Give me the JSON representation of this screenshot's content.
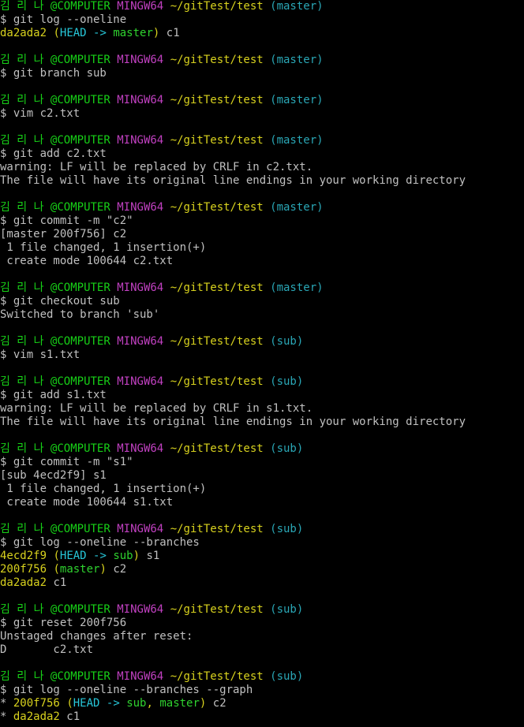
{
  "terminal": {
    "colors": {
      "background": "#000000",
      "default_text": "#c0c0c0",
      "user_host": "#17d017",
      "system": "#c040c0",
      "path": "#d8d21e",
      "branch": "#2aa7b6",
      "commit_hash": "#d8d21e",
      "head_ref": "#27c7d9",
      "branch_ref": "#2fd22f"
    },
    "lines": [
      [
        {
          "t": "김 리 나 @COMPUTER",
          "c": "green"
        },
        {
          "t": " ",
          "c": "white"
        },
        {
          "t": "MINGW64",
          "c": "magenta"
        },
        {
          "t": " ",
          "c": "white"
        },
        {
          "t": "~/gitTest/test",
          "c": "yellow"
        },
        {
          "t": " ",
          "c": "white"
        },
        {
          "t": "(master)",
          "c": "cyan"
        }
      ],
      [
        {
          "t": "$ git log --oneline",
          "c": "white"
        }
      ],
      [
        {
          "t": "da2ada2",
          "c": "yellow"
        },
        {
          "t": " ",
          "c": "white"
        },
        {
          "t": "(",
          "c": "yellow"
        },
        {
          "t": "HEAD -> ",
          "c": "cyanb"
        },
        {
          "t": "master",
          "c": "greenb"
        },
        {
          "t": ")",
          "c": "yellow"
        },
        {
          "t": " c1",
          "c": "white"
        }
      ],
      [],
      [
        {
          "t": "김 리 나 @COMPUTER",
          "c": "green"
        },
        {
          "t": " ",
          "c": "white"
        },
        {
          "t": "MINGW64",
          "c": "magenta"
        },
        {
          "t": " ",
          "c": "white"
        },
        {
          "t": "~/gitTest/test",
          "c": "yellow"
        },
        {
          "t": " ",
          "c": "white"
        },
        {
          "t": "(master)",
          "c": "cyan"
        }
      ],
      [
        {
          "t": "$ git branch sub",
          "c": "white"
        }
      ],
      [],
      [
        {
          "t": "김 리 나 @COMPUTER",
          "c": "green"
        },
        {
          "t": " ",
          "c": "white"
        },
        {
          "t": "MINGW64",
          "c": "magenta"
        },
        {
          "t": " ",
          "c": "white"
        },
        {
          "t": "~/gitTest/test",
          "c": "yellow"
        },
        {
          "t": " ",
          "c": "white"
        },
        {
          "t": "(master)",
          "c": "cyan"
        }
      ],
      [
        {
          "t": "$ vim c2.txt",
          "c": "white"
        }
      ],
      [],
      [
        {
          "t": "김 리 나 @COMPUTER",
          "c": "green"
        },
        {
          "t": " ",
          "c": "white"
        },
        {
          "t": "MINGW64",
          "c": "magenta"
        },
        {
          "t": " ",
          "c": "white"
        },
        {
          "t": "~/gitTest/test",
          "c": "yellow"
        },
        {
          "t": " ",
          "c": "white"
        },
        {
          "t": "(master)",
          "c": "cyan"
        }
      ],
      [
        {
          "t": "$ git add c2.txt",
          "c": "white"
        }
      ],
      [
        {
          "t": "warning: LF will be replaced by CRLF in c2.txt.",
          "c": "white"
        }
      ],
      [
        {
          "t": "The file will have its original line endings in your working directory",
          "c": "white"
        }
      ],
      [],
      [
        {
          "t": "김 리 나 @COMPUTER",
          "c": "green"
        },
        {
          "t": " ",
          "c": "white"
        },
        {
          "t": "MINGW64",
          "c": "magenta"
        },
        {
          "t": " ",
          "c": "white"
        },
        {
          "t": "~/gitTest/test",
          "c": "yellow"
        },
        {
          "t": " ",
          "c": "white"
        },
        {
          "t": "(master)",
          "c": "cyan"
        }
      ],
      [
        {
          "t": "$ git commit -m \"c2\"",
          "c": "white"
        }
      ],
      [
        {
          "t": "[master 200f756] c2",
          "c": "white"
        }
      ],
      [
        {
          "t": " 1 file changed, 1 insertion(+)",
          "c": "white"
        }
      ],
      [
        {
          "t": " create mode 100644 c2.txt",
          "c": "white"
        }
      ],
      [],
      [
        {
          "t": "김 리 나 @COMPUTER",
          "c": "green"
        },
        {
          "t": " ",
          "c": "white"
        },
        {
          "t": "MINGW64",
          "c": "magenta"
        },
        {
          "t": " ",
          "c": "white"
        },
        {
          "t": "~/gitTest/test",
          "c": "yellow"
        },
        {
          "t": " ",
          "c": "white"
        },
        {
          "t": "(master)",
          "c": "cyan"
        }
      ],
      [
        {
          "t": "$ git checkout sub",
          "c": "white"
        }
      ],
      [
        {
          "t": "Switched to branch 'sub'",
          "c": "white"
        }
      ],
      [],
      [
        {
          "t": "김 리 나 @COMPUTER",
          "c": "green"
        },
        {
          "t": " ",
          "c": "white"
        },
        {
          "t": "MINGW64",
          "c": "magenta"
        },
        {
          "t": " ",
          "c": "white"
        },
        {
          "t": "~/gitTest/test",
          "c": "yellow"
        },
        {
          "t": " ",
          "c": "white"
        },
        {
          "t": "(sub)",
          "c": "cyan"
        }
      ],
      [
        {
          "t": "$ vim s1.txt",
          "c": "white"
        }
      ],
      [],
      [
        {
          "t": "김 리 나 @COMPUTER",
          "c": "green"
        },
        {
          "t": " ",
          "c": "white"
        },
        {
          "t": "MINGW64",
          "c": "magenta"
        },
        {
          "t": " ",
          "c": "white"
        },
        {
          "t": "~/gitTest/test",
          "c": "yellow"
        },
        {
          "t": " ",
          "c": "white"
        },
        {
          "t": "(sub)",
          "c": "cyan"
        }
      ],
      [
        {
          "t": "$ git add s1.txt",
          "c": "white"
        }
      ],
      [
        {
          "t": "warning: LF will be replaced by CRLF in s1.txt.",
          "c": "white"
        }
      ],
      [
        {
          "t": "The file will have its original line endings in your working directory",
          "c": "white"
        }
      ],
      [],
      [
        {
          "t": "김 리 나 @COMPUTER",
          "c": "green"
        },
        {
          "t": " ",
          "c": "white"
        },
        {
          "t": "MINGW64",
          "c": "magenta"
        },
        {
          "t": " ",
          "c": "white"
        },
        {
          "t": "~/gitTest/test",
          "c": "yellow"
        },
        {
          "t": " ",
          "c": "white"
        },
        {
          "t": "(sub)",
          "c": "cyan"
        }
      ],
      [
        {
          "t": "$ git commit -m \"s1\"",
          "c": "white"
        }
      ],
      [
        {
          "t": "[sub 4ecd2f9] s1",
          "c": "white"
        }
      ],
      [
        {
          "t": " 1 file changed, 1 insertion(+)",
          "c": "white"
        }
      ],
      [
        {
          "t": " create mode 100644 s1.txt",
          "c": "white"
        }
      ],
      [],
      [
        {
          "t": "김 리 나 @COMPUTER",
          "c": "green"
        },
        {
          "t": " ",
          "c": "white"
        },
        {
          "t": "MINGW64",
          "c": "magenta"
        },
        {
          "t": " ",
          "c": "white"
        },
        {
          "t": "~/gitTest/test",
          "c": "yellow"
        },
        {
          "t": " ",
          "c": "white"
        },
        {
          "t": "(sub)",
          "c": "cyan"
        }
      ],
      [
        {
          "t": "$ git log --oneline --branches",
          "c": "white"
        }
      ],
      [
        {
          "t": "4ecd2f9",
          "c": "yellow"
        },
        {
          "t": " ",
          "c": "white"
        },
        {
          "t": "(",
          "c": "yellow"
        },
        {
          "t": "HEAD -> ",
          "c": "cyanb"
        },
        {
          "t": "sub",
          "c": "greenb"
        },
        {
          "t": ")",
          "c": "yellow"
        },
        {
          "t": " s1",
          "c": "white"
        }
      ],
      [
        {
          "t": "200f756",
          "c": "yellow"
        },
        {
          "t": " ",
          "c": "white"
        },
        {
          "t": "(",
          "c": "yellow"
        },
        {
          "t": "master",
          "c": "greenb"
        },
        {
          "t": ")",
          "c": "yellow"
        },
        {
          "t": " c2",
          "c": "white"
        }
      ],
      [
        {
          "t": "da2ada2",
          "c": "yellow"
        },
        {
          "t": " c1",
          "c": "white"
        }
      ],
      [],
      [
        {
          "t": "김 리 나 @COMPUTER",
          "c": "green"
        },
        {
          "t": " ",
          "c": "white"
        },
        {
          "t": "MINGW64",
          "c": "magenta"
        },
        {
          "t": " ",
          "c": "white"
        },
        {
          "t": "~/gitTest/test",
          "c": "yellow"
        },
        {
          "t": " ",
          "c": "white"
        },
        {
          "t": "(sub)",
          "c": "cyan"
        }
      ],
      [
        {
          "t": "$ git reset 200f756",
          "c": "white"
        }
      ],
      [
        {
          "t": "Unstaged changes after reset:",
          "c": "white"
        }
      ],
      [
        {
          "t": "D       c2.txt",
          "c": "white"
        }
      ],
      [],
      [
        {
          "t": "김 리 나 @COMPUTER",
          "c": "green"
        },
        {
          "t": " ",
          "c": "white"
        },
        {
          "t": "MINGW64",
          "c": "magenta"
        },
        {
          "t": " ",
          "c": "white"
        },
        {
          "t": "~/gitTest/test",
          "c": "yellow"
        },
        {
          "t": " ",
          "c": "white"
        },
        {
          "t": "(sub)",
          "c": "cyan"
        }
      ],
      [
        {
          "t": "$ git log --oneline --branches --graph",
          "c": "white"
        }
      ],
      [
        {
          "t": "* ",
          "c": "white"
        },
        {
          "t": "200f756",
          "c": "yellow"
        },
        {
          "t": " ",
          "c": "white"
        },
        {
          "t": "(",
          "c": "yellow"
        },
        {
          "t": "HEAD -> ",
          "c": "cyanb"
        },
        {
          "t": "sub",
          "c": "greenb"
        },
        {
          "t": ", ",
          "c": "yellow"
        },
        {
          "t": "master",
          "c": "greenb"
        },
        {
          "t": ")",
          "c": "yellow"
        },
        {
          "t": " c2",
          "c": "white"
        }
      ],
      [
        {
          "t": "* ",
          "c": "white"
        },
        {
          "t": "da2ada2",
          "c": "yellow"
        },
        {
          "t": " c1",
          "c": "white"
        }
      ]
    ]
  }
}
